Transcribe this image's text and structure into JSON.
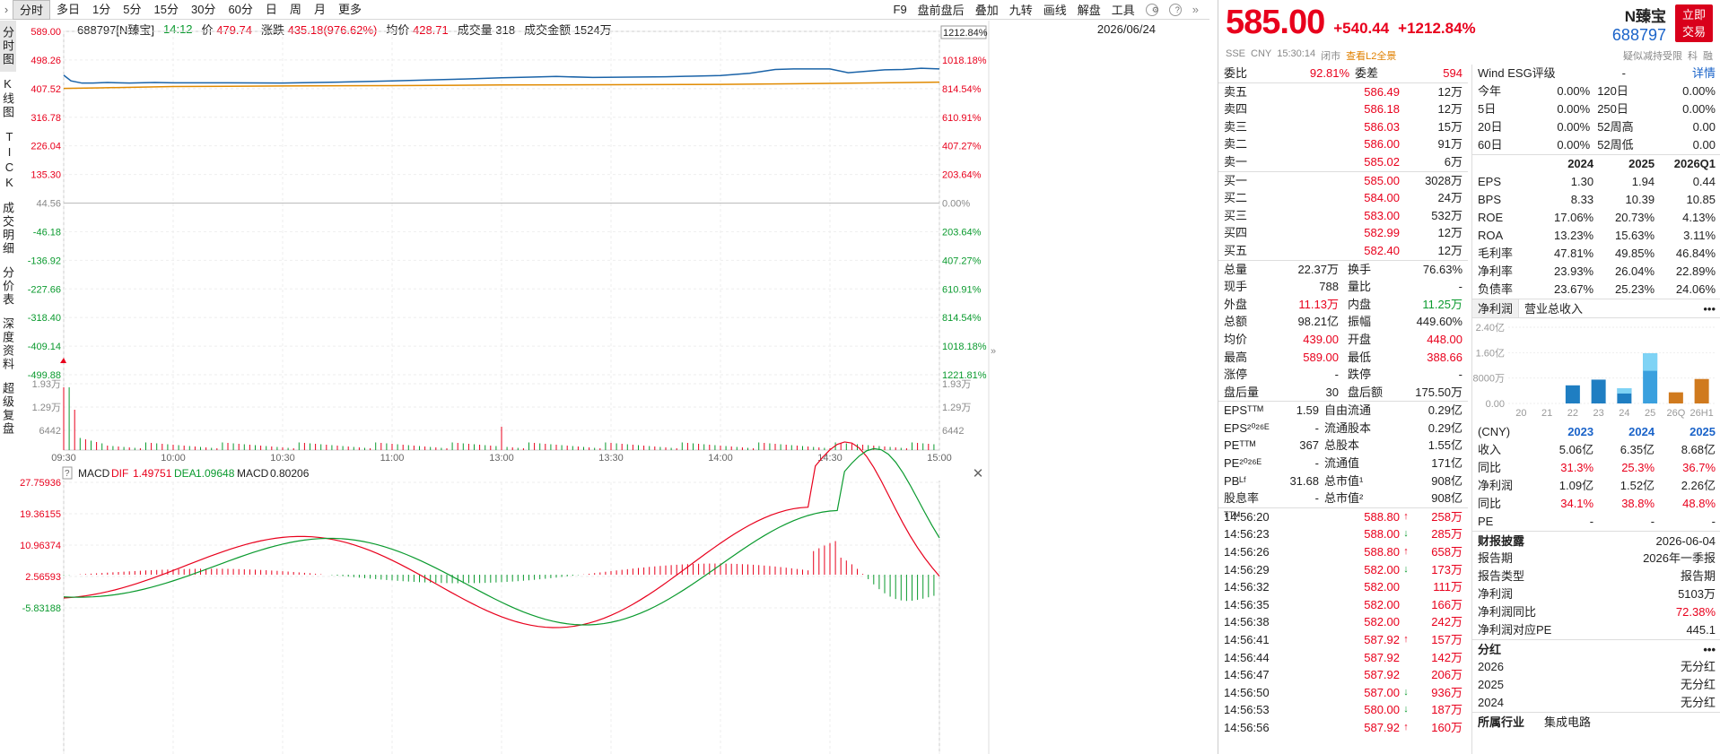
{
  "toolbar": {
    "period_tabs": [
      "分时",
      "多日",
      "1分",
      "5分",
      "15分",
      "30分",
      "60分",
      "日",
      "周",
      "月",
      "更多"
    ],
    "tool_tabs": [
      "F9",
      "盘前盘后",
      "叠加",
      "九转",
      "画线",
      "解盘",
      "工具"
    ]
  },
  "infobar": {
    "code_name": "688797[N臻宝]",
    "time": "14:12",
    "price_label": "价",
    "price": "479.74",
    "change_label": "涨跌",
    "change": "435.18(976.62%)",
    "avg_label": "均价",
    "avg": "428.71",
    "vol_label": "成交量",
    "vol": "318",
    "amount_label": "成交金额",
    "amount": "1524万",
    "date": "2026/06/24"
  },
  "leftnav": [
    "分时图",
    "K线图",
    "TICK",
    "成交明细",
    "分价表",
    "深度资料",
    "超级复盘"
  ],
  "chart_data": {
    "type": "line",
    "price_axis_left": [
      "589.00",
      "498.26",
      "407.52",
      "316.78",
      "226.04",
      "135.30",
      "44.56",
      "-46.18",
      "-136.92",
      "-227.66",
      "-318.40",
      "-409.14",
      "-499.88"
    ],
    "pct_axis_right": [
      "1212.84%",
      "1018.18%",
      "814.54%",
      "610.91%",
      "407.27%",
      "203.64%",
      "0.00%",
      "203.64%",
      "407.27%",
      "610.91%",
      "814.54%",
      "1018.18%",
      "1221.81%"
    ],
    "current_pct_label": "1212.84%",
    "volume_axis": [
      "1.93万",
      "1.29万",
      "6442"
    ],
    "time_axis": [
      "09:30",
      "10:00",
      "10:30",
      "11:00",
      "13:00",
      "13:30",
      "14:00",
      "14:30",
      "15:00"
    ],
    "ylim": [
      -499.88,
      589.0
    ],
    "series": [
      {
        "name": "价",
        "color": "#1a63a8",
        "x": [
          0,
          2,
          5,
          8,
          12,
          18,
          25,
          30,
          38,
          45,
          60,
          75,
          90,
          110,
          120,
          128,
          135,
          145,
          155,
          165,
          172,
          180,
          188,
          195,
          200,
          205,
          210,
          215,
          225,
          230,
          235,
          240
        ],
        "y": [
          450,
          432,
          425,
          425,
          427,
          425,
          427,
          426,
          426,
          426,
          425,
          428,
          432,
          438,
          442,
          444,
          446,
          443,
          444,
          445,
          447,
          449,
          456,
          468,
          470,
          470,
          470,
          458,
          467,
          468,
          472,
          470
        ]
      },
      {
        "name": "均价",
        "color": "#e08a00",
        "x": [
          0,
          10,
          30,
          60,
          90,
          120,
          150,
          180,
          210,
          240
        ],
        "y": [
          408,
          410,
          414,
          416,
          417,
          419,
          420,
          421,
          424,
          428
        ]
      }
    ],
    "macd": {
      "label": "MACD",
      "dif_label": "DIF",
      "dif": "1.49751",
      "dea_label": "DEA",
      "dea": "1.09648",
      "macd_label": "MACD",
      "macd": "0.80206",
      "axis": [
        "27.75936",
        "19.36155",
        "10.96374",
        "2.56593",
        "-5.83188"
      ]
    }
  },
  "quote": {
    "price": "585.00",
    "change": "+540.44",
    "change_pct": "+1212.84%",
    "name": "N臻宝",
    "code": "688797",
    "trade_btn": "立即交易",
    "sub": [
      "SSE",
      "CNY",
      "15:30:14",
      "闭市"
    ],
    "l2": "查看L2全景",
    "sub_right": [
      "疑似减持受限",
      "科",
      "融"
    ],
    "wb_label": "委比",
    "wb": "92.81%",
    "wc_label": "委差",
    "wc": "594",
    "asks": [
      [
        "卖五",
        "586.49",
        "12万"
      ],
      [
        "卖四",
        "586.18",
        "12万"
      ],
      [
        "卖三",
        "586.03",
        "15万"
      ],
      [
        "卖二",
        "586.00",
        "91万"
      ],
      [
        "卖一",
        "585.02",
        "6万"
      ]
    ],
    "bids": [
      [
        "买一",
        "585.00",
        "3028万"
      ],
      [
        "买二",
        "584.00",
        "24万"
      ],
      [
        "买三",
        "583.00",
        "532万"
      ],
      [
        "买四",
        "582.99",
        "12万"
      ],
      [
        "买五",
        "582.40",
        "12万"
      ]
    ],
    "stats": [
      [
        "总量",
        "22.37万",
        "换手",
        "76.63%"
      ],
      [
        "现手",
        "788",
        "量比",
        "-"
      ],
      [
        "外盘",
        "11.13万",
        "内盘",
        "11.25万"
      ],
      [
        "总额",
        "98.21亿",
        "振幅",
        "449.60%"
      ],
      [
        "均价",
        "439.00",
        "开盘",
        "448.00"
      ],
      [
        "最高",
        "589.00",
        "最低",
        "388.66"
      ],
      [
        "涨停",
        "-",
        "跌停",
        "-"
      ],
      [
        "盘后量",
        "30",
        "盘后额",
        "175.50万"
      ]
    ],
    "valuation": [
      [
        "EPSᵀᵀᴹ",
        "1.59",
        "自由流通",
        "0.29亿"
      ],
      [
        "EPS²⁰²⁶ᴱ",
        "-",
        "流通股本",
        "0.29亿"
      ],
      [
        "PEᵀᵀᴹ",
        "367",
        "总股本",
        "1.55亿"
      ],
      [
        "PE²⁰²⁶ᴱ",
        "-",
        "流通值",
        "171亿"
      ],
      [
        "PBᴸᶠ",
        "31.68",
        "总市值¹",
        "908亿"
      ],
      [
        "股息率ᵀᵀᴹ",
        "-",
        "总市值²",
        "908亿"
      ]
    ],
    "ticks": [
      [
        "14:56:20",
        "588.80",
        "up",
        "258万"
      ],
      [
        "14:56:23",
        "588.00",
        "down",
        "285万"
      ],
      [
        "14:56:26",
        "588.80",
        "up",
        "658万"
      ],
      [
        "14:56:29",
        "582.00",
        "down",
        "173万"
      ],
      [
        "14:56:32",
        "582.00",
        "",
        "111万"
      ],
      [
        "14:56:35",
        "582.00",
        "",
        "166万"
      ],
      [
        "14:56:38",
        "582.00",
        "",
        "242万"
      ],
      [
        "14:56:41",
        "587.92",
        "up",
        "157万"
      ],
      [
        "14:56:44",
        "587.92",
        "",
        "142万"
      ],
      [
        "14:56:47",
        "587.92",
        "",
        "206万"
      ],
      [
        "14:56:50",
        "587.00",
        "down",
        "936万"
      ],
      [
        "14:56:53",
        "580.00",
        "down",
        "187万"
      ],
      [
        "14:56:56",
        "587.92",
        "up",
        "160万"
      ]
    ]
  },
  "fund": {
    "esg_label": "Wind ESG评级",
    "esg_value": "-",
    "detail": "详情",
    "perf": [
      [
        "今年",
        "0.00%",
        "120日",
        "0.00%"
      ],
      [
        "5日",
        "0.00%",
        "250日",
        "0.00%"
      ],
      [
        "20日",
        "0.00%",
        "52周高",
        "0.00"
      ],
      [
        "60日",
        "0.00%",
        "52周低",
        "0.00"
      ]
    ],
    "fin_head": [
      "",
      "2024",
      "2025",
      "2026Q1"
    ],
    "fin": [
      [
        "EPS",
        "1.30",
        "1.94",
        "0.44"
      ],
      [
        "BPS",
        "8.33",
        "10.39",
        "10.85"
      ],
      [
        "ROE",
        "17.06%",
        "20.73%",
        "4.13%"
      ],
      [
        "ROA",
        "13.23%",
        "15.63%",
        "3.11%"
      ],
      [
        "毛利率",
        "47.81%",
        "49.85%",
        "46.84%"
      ],
      [
        "净利率",
        "23.93%",
        "26.04%",
        "22.89%"
      ],
      [
        "负债率",
        "23.67%",
        "25.23%",
        "24.06%"
      ]
    ],
    "tabs": [
      "净利润",
      "营业总收入"
    ],
    "mini_axis": [
      "2.40亿",
      "1.60亿",
      "8000万",
      "0.00"
    ],
    "mini_x": [
      "20",
      "21",
      "22",
      "23",
      "24",
      "25",
      "26Q",
      "26H1"
    ],
    "mini_bars": [
      0,
      0,
      0.57,
      0.75,
      0.48,
      1.58,
      0.35,
      0.77
    ],
    "cny_label": "(CNY)",
    "year_head": [
      "2023",
      "2024",
      "2025"
    ],
    "income": [
      [
        "收入",
        "5.06亿",
        "6.35亿",
        "8.68亿"
      ],
      [
        "同比",
        "31.3%",
        "25.3%",
        "36.7%"
      ],
      [
        "净利润",
        "1.09亿",
        "1.52亿",
        "2.26亿"
      ],
      [
        "同比",
        "34.1%",
        "38.8%",
        "48.8%"
      ],
      [
        "PE",
        "-",
        "-",
        "-"
      ]
    ],
    "report_title": "财报披露",
    "report_date": "2026-06-04",
    "report": [
      [
        "报告期",
        "2026年一季报"
      ],
      [
        "报告类型",
        "报告期"
      ],
      [
        "净利润",
        "5103万"
      ],
      [
        "净利润同比",
        "72.38%"
      ],
      [
        "净利润对应PE",
        "445.1"
      ]
    ],
    "div_title": "分红",
    "divs": [
      [
        "2026",
        "无分红"
      ],
      [
        "2025",
        "无分红"
      ],
      [
        "2024",
        "无分红"
      ]
    ],
    "industry_label": "所属行业",
    "industry": "集成电路"
  }
}
